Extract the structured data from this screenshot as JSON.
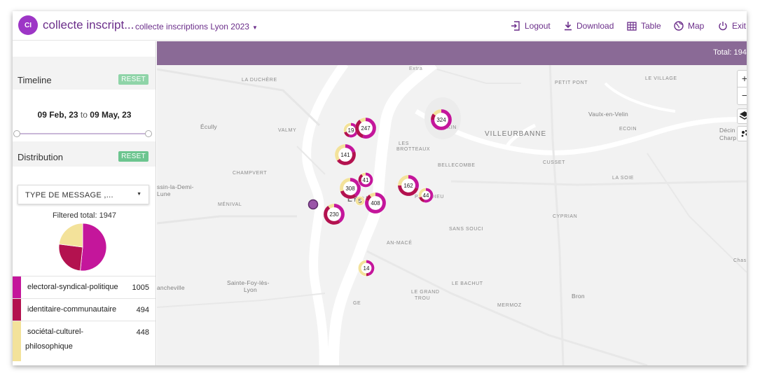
{
  "header": {
    "avatar_initials": "CI",
    "app_title": "collecte inscript...",
    "project_name": "collecte inscriptions Lyon 2023",
    "nav": {
      "logout": "Logout",
      "download": "Download",
      "table": "Table",
      "map": "Map",
      "exit": "Exit"
    }
  },
  "sidebar": {
    "timeline": {
      "title": "Timeline",
      "reset_label": "RESET",
      "date_from": "09 Feb, 23",
      "date_sep": "to",
      "date_to": "09 May, 23"
    },
    "distribution": {
      "title": "Distribution",
      "reset_label": "RESET",
      "select_value": "TYPE DE MESSAGE ,...",
      "filtered_total_label": "Filtered total: 1947",
      "categories": [
        {
          "name": "electoral-syndical-politique",
          "count": "1005",
          "color": "#c4169b"
        },
        {
          "name": "identitaire-communautaire",
          "count": "494",
          "color": "#b3124f"
        },
        {
          "name_line1": "sociétal-culturel-",
          "name_line2": "philosophique",
          "count": "448",
          "color": "#f3e29a"
        }
      ]
    }
  },
  "map": {
    "total_label": "Total: 1947",
    "zoom_in": "+",
    "zoom_out": "−",
    "labels": {
      "la_duchere": "LA DUCHÈRE",
      "petit_pont": "PETIT PONT",
      "le_village": "LE VILLAGE",
      "vaulx": "Vaulx-en-Velin",
      "ecoin": "ECOIN",
      "ecully": "Écully",
      "valmy": "VALMY",
      "tonkin": "TONKIN",
      "villeurbanne": "VILLEURBANNE",
      "decine": "Décin",
      "charp": "Charp",
      "les_brotteaux_1": "LES",
      "les_brotteaux_2": "BROTTEAUX",
      "bellecombe": "BELLECOMBE",
      "champvert": "CHAMPVERT",
      "cusset": "CUSSET",
      "saint_lambert": "ssin-la-Demi-",
      "saint_lambert_2": "Lune",
      "la_soie": "LA SOIE",
      "part_dieu": "PART-DIEU",
      "menival": "MÉNIVAL",
      "lyon": "LYON",
      "cyprian": "CYPRIAN",
      "sans_souci": "SANS SOUCI",
      "jean_mace": "AN-MACÉ",
      "chas": "Chas",
      "saint_foy_1": "Sainte-Foy-lès-",
      "saint_foy_2": "Lyon",
      "francheville": "ancheville",
      "le_bachut": "LE BACHUT",
      "bron": "Bron",
      "le_grand_trou_1": "LE GRAND",
      "le_grand_trou_2": "TROU",
      "gerland": "GE",
      "mermoz": "MERMOZ",
      "extra": "Extra"
    },
    "clusters": [
      {
        "count": "19",
        "electoral": 0.55,
        "identitaire": 0.15,
        "societal": 0.3
      },
      {
        "count": "247",
        "electoral": 0.55,
        "identitaire": 0.35,
        "societal": 0.1
      },
      {
        "count": "324",
        "electoral": 0.75,
        "identitaire": 0.1,
        "societal": 0.15
      },
      {
        "count": "141",
        "electoral": 0.2,
        "identitaire": 0.45,
        "societal": 0.35
      },
      {
        "count": "41",
        "electoral": 0.7,
        "identitaire": 0.2,
        "societal": 0.1
      },
      {
        "count": "308",
        "electoral": 0.4,
        "identitaire": 0.3,
        "societal": 0.3
      },
      {
        "count": "162",
        "electoral": 0.3,
        "identitaire": 0.45,
        "societal": 0.25
      },
      {
        "count": "44",
        "electoral": 0.55,
        "identitaire": 0.15,
        "societal": 0.3
      },
      {
        "count": "5",
        "electoral": 0.0,
        "identitaire": 0.0,
        "societal": 1.0
      },
      {
        "count": "408",
        "electoral": 0.8,
        "identitaire": 0.1,
        "societal": 0.1
      },
      {
        "count": "230",
        "electoral": 0.4,
        "identitaire": 0.5,
        "societal": 0.1
      },
      {
        "count": "14",
        "electoral": 0.45,
        "identitaire": 0.05,
        "societal": 0.5
      }
    ]
  }
}
